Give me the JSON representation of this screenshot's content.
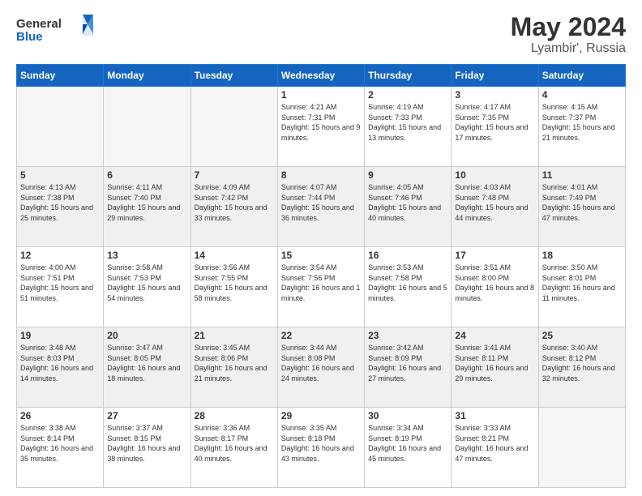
{
  "header": {
    "logo_general": "General",
    "logo_blue": "Blue",
    "title": "May 2024",
    "location": "Lyambir', Russia"
  },
  "weekdays": [
    "Sunday",
    "Monday",
    "Tuesday",
    "Wednesday",
    "Thursday",
    "Friday",
    "Saturday"
  ],
  "weeks": [
    [
      {
        "day": "",
        "sunrise": "",
        "sunset": "",
        "daylight": "",
        "empty": true
      },
      {
        "day": "",
        "sunrise": "",
        "sunset": "",
        "daylight": "",
        "empty": true
      },
      {
        "day": "",
        "sunrise": "",
        "sunset": "",
        "daylight": "",
        "empty": true
      },
      {
        "day": "1",
        "sunrise": "Sunrise: 4:21 AM",
        "sunset": "Sunset: 7:31 PM",
        "daylight": "Daylight: 15 hours and 9 minutes.",
        "empty": false
      },
      {
        "day": "2",
        "sunrise": "Sunrise: 4:19 AM",
        "sunset": "Sunset: 7:33 PM",
        "daylight": "Daylight: 15 hours and 13 minutes.",
        "empty": false
      },
      {
        "day": "3",
        "sunrise": "Sunrise: 4:17 AM",
        "sunset": "Sunset: 7:35 PM",
        "daylight": "Daylight: 15 hours and 17 minutes.",
        "empty": false
      },
      {
        "day": "4",
        "sunrise": "Sunrise: 4:15 AM",
        "sunset": "Sunset: 7:37 PM",
        "daylight": "Daylight: 15 hours and 21 minutes.",
        "empty": false
      }
    ],
    [
      {
        "day": "5",
        "sunrise": "Sunrise: 4:13 AM",
        "sunset": "Sunset: 7:38 PM",
        "daylight": "Daylight: 15 hours and 25 minutes.",
        "empty": false
      },
      {
        "day": "6",
        "sunrise": "Sunrise: 4:11 AM",
        "sunset": "Sunset: 7:40 PM",
        "daylight": "Daylight: 15 hours and 29 minutes.",
        "empty": false
      },
      {
        "day": "7",
        "sunrise": "Sunrise: 4:09 AM",
        "sunset": "Sunset: 7:42 PM",
        "daylight": "Daylight: 15 hours and 33 minutes.",
        "empty": false
      },
      {
        "day": "8",
        "sunrise": "Sunrise: 4:07 AM",
        "sunset": "Sunset: 7:44 PM",
        "daylight": "Daylight: 15 hours and 36 minutes.",
        "empty": false
      },
      {
        "day": "9",
        "sunrise": "Sunrise: 4:05 AM",
        "sunset": "Sunset: 7:46 PM",
        "daylight": "Daylight: 15 hours and 40 minutes.",
        "empty": false
      },
      {
        "day": "10",
        "sunrise": "Sunrise: 4:03 AM",
        "sunset": "Sunset: 7:48 PM",
        "daylight": "Daylight: 15 hours and 44 minutes.",
        "empty": false
      },
      {
        "day": "11",
        "sunrise": "Sunrise: 4:01 AM",
        "sunset": "Sunset: 7:49 PM",
        "daylight": "Daylight: 15 hours and 47 minutes.",
        "empty": false
      }
    ],
    [
      {
        "day": "12",
        "sunrise": "Sunrise: 4:00 AM",
        "sunset": "Sunset: 7:51 PM",
        "daylight": "Daylight: 15 hours and 51 minutes.",
        "empty": false
      },
      {
        "day": "13",
        "sunrise": "Sunrise: 3:58 AM",
        "sunset": "Sunset: 7:53 PM",
        "daylight": "Daylight: 15 hours and 54 minutes.",
        "empty": false
      },
      {
        "day": "14",
        "sunrise": "Sunrise: 3:56 AM",
        "sunset": "Sunset: 7:55 PM",
        "daylight": "Daylight: 15 hours and 58 minutes.",
        "empty": false
      },
      {
        "day": "15",
        "sunrise": "Sunrise: 3:54 AM",
        "sunset": "Sunset: 7:56 PM",
        "daylight": "Daylight: 16 hours and 1 minute.",
        "empty": false
      },
      {
        "day": "16",
        "sunrise": "Sunrise: 3:53 AM",
        "sunset": "Sunset: 7:58 PM",
        "daylight": "Daylight: 16 hours and 5 minutes.",
        "empty": false
      },
      {
        "day": "17",
        "sunrise": "Sunrise: 3:51 AM",
        "sunset": "Sunset: 8:00 PM",
        "daylight": "Daylight: 16 hours and 8 minutes.",
        "empty": false
      },
      {
        "day": "18",
        "sunrise": "Sunrise: 3:50 AM",
        "sunset": "Sunset: 8:01 PM",
        "daylight": "Daylight: 16 hours and 11 minutes.",
        "empty": false
      }
    ],
    [
      {
        "day": "19",
        "sunrise": "Sunrise: 3:48 AM",
        "sunset": "Sunset: 8:03 PM",
        "daylight": "Daylight: 16 hours and 14 minutes.",
        "empty": false
      },
      {
        "day": "20",
        "sunrise": "Sunrise: 3:47 AM",
        "sunset": "Sunset: 8:05 PM",
        "daylight": "Daylight: 16 hours and 18 minutes.",
        "empty": false
      },
      {
        "day": "21",
        "sunrise": "Sunrise: 3:45 AM",
        "sunset": "Sunset: 8:06 PM",
        "daylight": "Daylight: 16 hours and 21 minutes.",
        "empty": false
      },
      {
        "day": "22",
        "sunrise": "Sunrise: 3:44 AM",
        "sunset": "Sunset: 8:08 PM",
        "daylight": "Daylight: 16 hours and 24 minutes.",
        "empty": false
      },
      {
        "day": "23",
        "sunrise": "Sunrise: 3:42 AM",
        "sunset": "Sunset: 8:09 PM",
        "daylight": "Daylight: 16 hours and 27 minutes.",
        "empty": false
      },
      {
        "day": "24",
        "sunrise": "Sunrise: 3:41 AM",
        "sunset": "Sunset: 8:11 PM",
        "daylight": "Daylight: 16 hours and 29 minutes.",
        "empty": false
      },
      {
        "day": "25",
        "sunrise": "Sunrise: 3:40 AM",
        "sunset": "Sunset: 8:12 PM",
        "daylight": "Daylight: 16 hours and 32 minutes.",
        "empty": false
      }
    ],
    [
      {
        "day": "26",
        "sunrise": "Sunrise: 3:38 AM",
        "sunset": "Sunset: 8:14 PM",
        "daylight": "Daylight: 16 hours and 35 minutes.",
        "empty": false
      },
      {
        "day": "27",
        "sunrise": "Sunrise: 3:37 AM",
        "sunset": "Sunset: 8:15 PM",
        "daylight": "Daylight: 16 hours and 38 minutes.",
        "empty": false
      },
      {
        "day": "28",
        "sunrise": "Sunrise: 3:36 AM",
        "sunset": "Sunset: 8:17 PM",
        "daylight": "Daylight: 16 hours and 40 minutes.",
        "empty": false
      },
      {
        "day": "29",
        "sunrise": "Sunrise: 3:35 AM",
        "sunset": "Sunset: 8:18 PM",
        "daylight": "Daylight: 16 hours and 43 minutes.",
        "empty": false
      },
      {
        "day": "30",
        "sunrise": "Sunrise: 3:34 AM",
        "sunset": "Sunset: 8:19 PM",
        "daylight": "Daylight: 16 hours and 45 minutes.",
        "empty": false
      },
      {
        "day": "31",
        "sunrise": "Sunrise: 3:33 AM",
        "sunset": "Sunset: 8:21 PM",
        "daylight": "Daylight: 16 hours and 47 minutes.",
        "empty": false
      },
      {
        "day": "",
        "sunrise": "",
        "sunset": "",
        "daylight": "",
        "empty": true
      }
    ]
  ]
}
